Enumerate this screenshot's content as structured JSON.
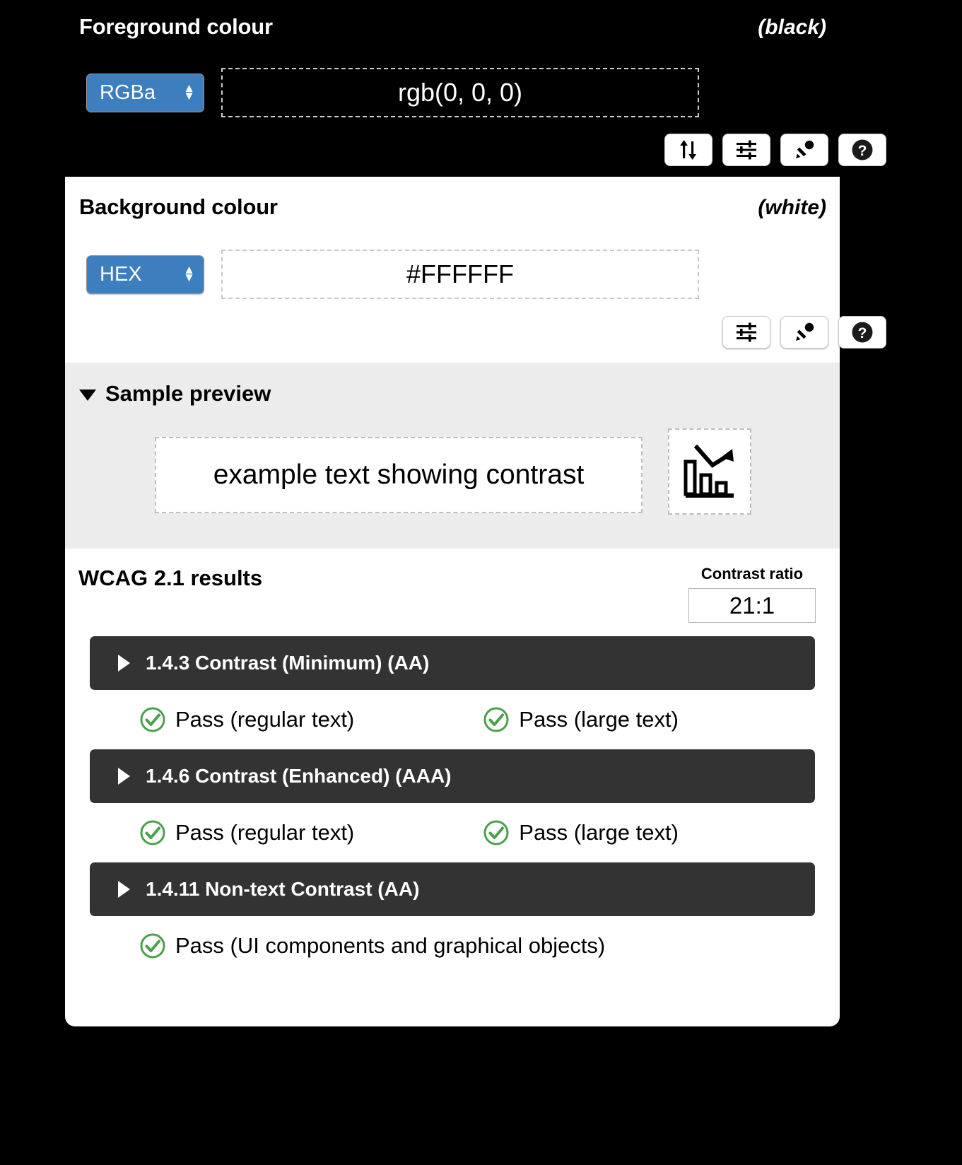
{
  "foreground": {
    "title": "Foreground colour",
    "note": "(black)",
    "format": "RGBa",
    "value": "rgb(0, 0, 0)",
    "tools": [
      {
        "name": "swap-colours-button",
        "icon": "swap-vertical-icon"
      },
      {
        "name": "adjust-sliders-button",
        "icon": "sliders-icon"
      },
      {
        "name": "eyedropper-button",
        "icon": "eyedropper-icon"
      },
      {
        "name": "help-button",
        "icon": "question-circle-icon"
      }
    ]
  },
  "background": {
    "title": "Background colour",
    "note": "(white)",
    "format": "HEX",
    "value": "#FFFFFF",
    "tools": [
      {
        "name": "adjust-sliders-button",
        "icon": "sliders-icon"
      },
      {
        "name": "eyedropper-button",
        "icon": "eyedropper-icon"
      },
      {
        "name": "help-button",
        "icon": "question-circle-icon"
      }
    ]
  },
  "preview": {
    "title": "Sample preview",
    "sample_text": "example text showing contrast",
    "icon": "bar-chart-declining-icon"
  },
  "results": {
    "title": "WCAG 2.1 results",
    "ratio_label": "Contrast ratio",
    "ratio_value": "21:1",
    "criteria": [
      {
        "label": "1.4.3 Contrast (Minimum) (AA)",
        "outcomes": [
          {
            "status": "Pass",
            "text": "Pass (regular text)"
          },
          {
            "status": "Pass",
            "text": "Pass (large text)"
          }
        ]
      },
      {
        "label": "1.4.6 Contrast (Enhanced) (AAA)",
        "outcomes": [
          {
            "status": "Pass",
            "text": "Pass (regular text)"
          },
          {
            "status": "Pass",
            "text": "Pass (large text)"
          }
        ]
      },
      {
        "label": "1.4.11 Non-text Contrast (AA)",
        "outcomes": [
          {
            "status": "Pass",
            "text": "Pass (UI components and graphical objects)"
          }
        ]
      }
    ]
  },
  "colors": {
    "select_blue": "#3d7ebf",
    "criteria_bar": "#333333",
    "pass_green": "#49a049",
    "preview_bg": "#ececec",
    "page_bg": "#000000"
  }
}
